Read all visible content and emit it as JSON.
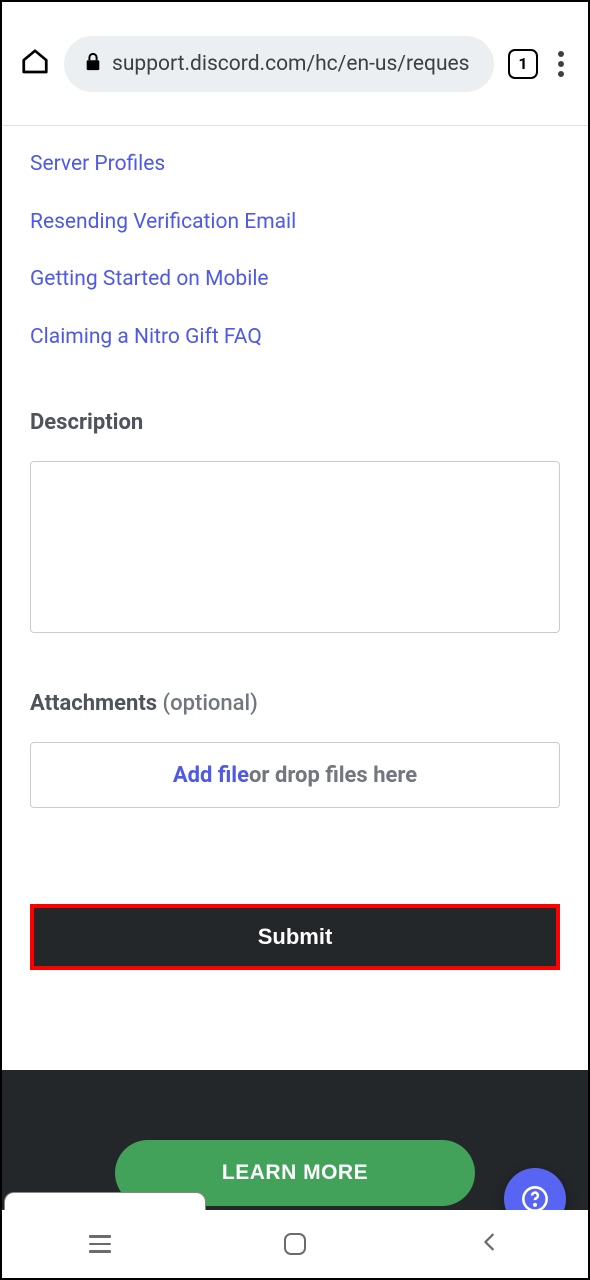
{
  "browser": {
    "url": "support.discord.com/hc/en-us/reques",
    "tab_count": "1"
  },
  "links": [
    "Server Profiles",
    "Resending Verification Email",
    "Getting Started on Mobile",
    "Claiming a Nitro Gift FAQ"
  ],
  "form": {
    "description_label": "Description",
    "attachments_label": "Attachments",
    "attachments_optional": " (optional)",
    "add_file": "Add file",
    "drop_text": " or drop files here",
    "submit_label": "Submit"
  },
  "footer": {
    "learn_more": "LEARN MORE"
  }
}
